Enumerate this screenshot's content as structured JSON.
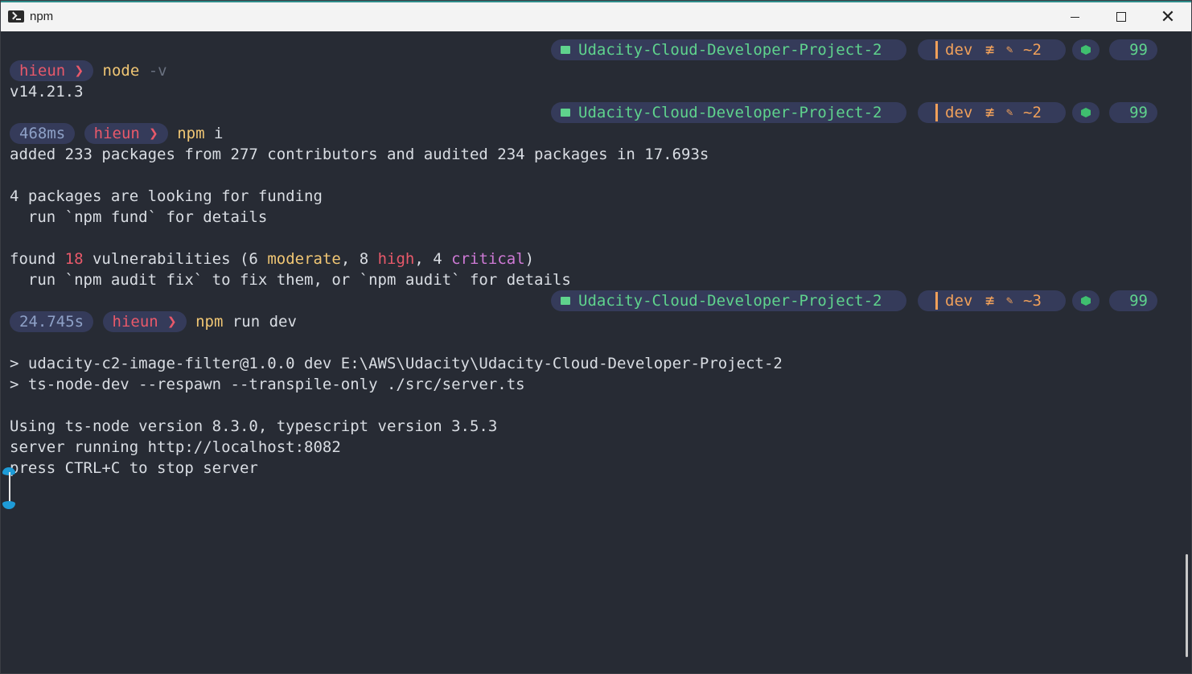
{
  "window": {
    "title": "npm"
  },
  "prompt_right": {
    "dir": "Udacity-Cloud-Developer-Project-2",
    "branch": "dev",
    "sync_glyph": "≢",
    "battery": "99",
    "changes": [
      "~2",
      "~2",
      "~3"
    ]
  },
  "lines": {
    "l1_user": "hieun ❯",
    "l1_cmd": "node",
    "l1_arg": " -v",
    "l2": "v14.21.3",
    "l3_dur": "468ms",
    "l3_user": "hieun ❯",
    "l3_cmd": "npm",
    "l3_arg": " i",
    "l4": "added 233 packages from 277 contributors and audited 234 packages in 17.693s",
    "l5": "4 packages are looking for funding",
    "l6": "  run `npm fund` for details",
    "l7_a": "found ",
    "l7_num": "18",
    "l7_b": " vulnerabilities (6 ",
    "l7_mod": "moderate",
    "l7_c": ", 8 ",
    "l7_high": "high",
    "l7_d": ", 4 ",
    "l7_crit": "critical",
    "l7_e": ")",
    "l8": "  run `npm audit fix` to fix them, or `npm audit` for details",
    "l9_dur": "24.745s",
    "l9_user": "hieun ❯",
    "l9_cmd": "npm",
    "l9_arg": " run dev",
    "l10": "> udacity-c2-image-filter@1.0.0 dev E:\\AWS\\Udacity\\Udacity-Cloud-Developer-Project-2",
    "l11": "> ts-node-dev --respawn --transpile-only ./src/server.ts",
    "l12": "Using ts-node version 8.3.0, typescript version 3.5.3",
    "l13": "server running http://localhost:8082",
    "l14": "press CTRL+C to stop server"
  },
  "colors": {
    "background": "#272b34",
    "user": "#e8596a",
    "command": "#f0c674",
    "dir": "#5fd38d",
    "git": "#f0a05a",
    "pill": "#353b5a"
  }
}
